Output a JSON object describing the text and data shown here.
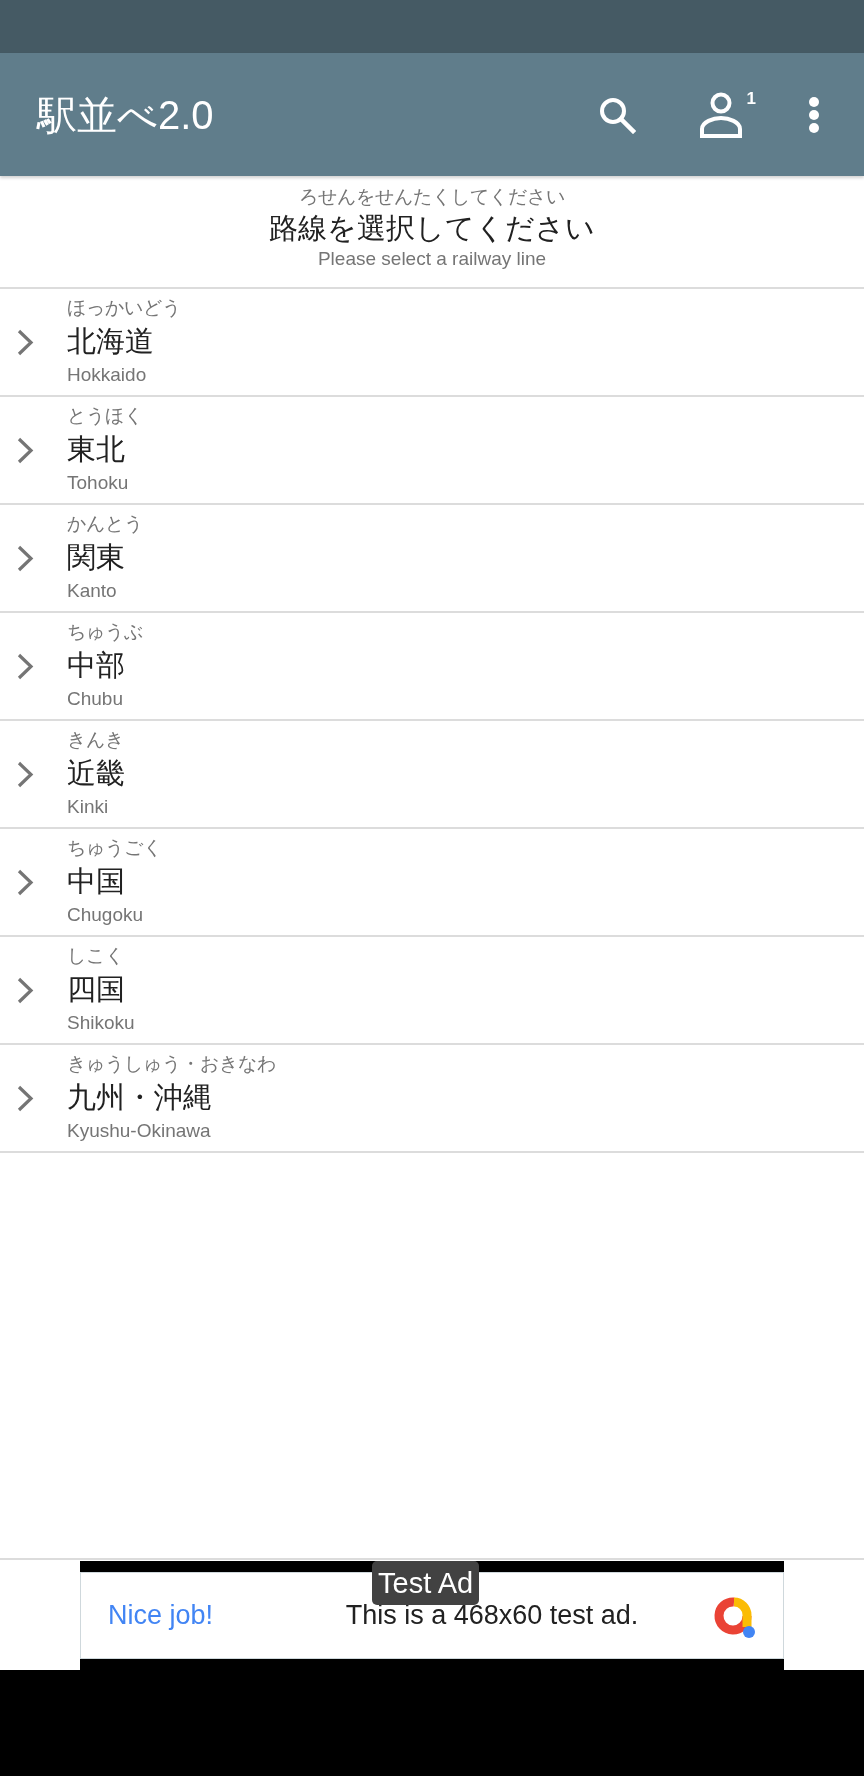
{
  "app_bar": {
    "title": "駅並べ2.0",
    "account_count": "1"
  },
  "prompt": {
    "ruby": "ろせんをせんたくしてください",
    "title": "路線を選択してください",
    "subtitle": "Please select a railway line"
  },
  "regions": [
    {
      "ruby": "ほっかいどう",
      "name": "北海道",
      "romaji": "Hokkaido",
      "expanded": false
    },
    {
      "ruby": "とうほく",
      "name": "東北",
      "romaji": "Tohoku",
      "expanded": false
    },
    {
      "ruby": "かんとう",
      "name": "関東",
      "romaji": "Kanto",
      "expanded": false
    },
    {
      "ruby": "ちゅうぶ",
      "name": "中部",
      "romaji": "Chubu",
      "expanded": false
    },
    {
      "ruby": "きんき",
      "name": "近畿",
      "romaji": "Kinki",
      "expanded": false
    },
    {
      "ruby": "ちゅうごく",
      "name": "中国",
      "romaji": "Chugoku",
      "expanded": false
    },
    {
      "ruby": "しこく",
      "name": "四国",
      "romaji": "Shikoku",
      "expanded": false
    },
    {
      "ruby": "きゅうしゅう・おきなわ",
      "name": "九州・沖縄",
      "romaji": "Kyushu-Okinawa",
      "expanded": false
    }
  ],
  "ad": {
    "label": "Test Ad",
    "headline": "Nice job!",
    "text": "This is a 468x60 test ad."
  }
}
